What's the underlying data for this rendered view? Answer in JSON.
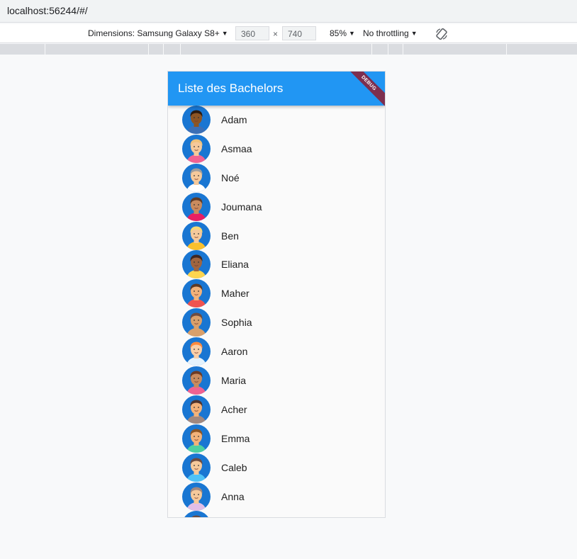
{
  "browser": {
    "url": "localhost:56244/#/"
  },
  "devtools": {
    "dimensions_label": "Dimensions: Samsung Galaxy S8+",
    "width": "360",
    "height": "740",
    "times": "×",
    "zoom": "85%",
    "throttling": "No throttling"
  },
  "app": {
    "title": "Liste des Bachelors",
    "banner": "DEBUG",
    "appbar_color": "#2196f3"
  },
  "bachelors": [
    {
      "name": "Adam",
      "skin": "#8d5524",
      "hair": "#2b1a10",
      "shirt": "#3b6fb6"
    },
    {
      "name": "Asmaa",
      "skin": "#f5c99b",
      "hair": "#f0c27b",
      "shirt": "#f06292"
    },
    {
      "name": "Noé",
      "skin": "#f5c99b",
      "hair": "#9e9e9e",
      "shirt": "#ffffff"
    },
    {
      "name": "Joumana",
      "skin": "#c98b5e",
      "hair": "#5d3a26",
      "shirt": "#e91e63"
    },
    {
      "name": "Ben",
      "skin": "#f5c99b",
      "hair": "#f7d774",
      "shirt": "#fbc02d"
    },
    {
      "name": "Eliana",
      "skin": "#a0653f",
      "hair": "#3e2723",
      "shirt": "#ffd54f"
    },
    {
      "name": "Maher",
      "skin": "#f2b27a",
      "hair": "#5d3a26",
      "shirt": "#ef5350"
    },
    {
      "name": "Sophia",
      "skin": "#d9a06b",
      "hair": "#6d4c41",
      "shirt": "#d9a06b"
    },
    {
      "name": "Aaron",
      "skin": "#f8cfa8",
      "hair": "#ff8a3d",
      "shirt": "#e3f2fd"
    },
    {
      "name": "Maria",
      "skin": "#c98b5e",
      "hair": "#6d3b24",
      "shirt": "#f06292"
    },
    {
      "name": "Acher",
      "skin": "#f2b27a",
      "hair": "#4e342e",
      "shirt": "#a1887f"
    },
    {
      "name": "Emma",
      "skin": "#f2b27a",
      "hair": "#8d5524",
      "shirt": "#4dd0a1"
    },
    {
      "name": "Caleb",
      "skin": "#f5c99b",
      "hair": "#6d4c41",
      "shirt": "#4fc3f7"
    },
    {
      "name": "Anna",
      "skin": "#f5c99b",
      "hair": "#a1887f",
      "shirt": "#e1bee7"
    },
    {
      "name": "",
      "skin": "#f2b27a",
      "hair": "#6d4c41",
      "shirt": "#7e57c2"
    }
  ]
}
